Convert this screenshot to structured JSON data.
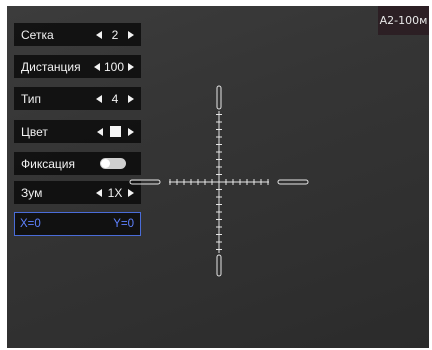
{
  "header": {
    "model": "A2-100м"
  },
  "menu": {
    "grid": {
      "label": "Сетка",
      "value": "2"
    },
    "distance": {
      "label": "Дистанция",
      "value": "100"
    },
    "type": {
      "label": "Тип",
      "value": "4"
    },
    "color": {
      "label": "Цвет",
      "value_color": "#f4f4f4"
    },
    "fixation": {
      "label": "Фиксация",
      "enabled": false
    },
    "zoom": {
      "label": "Зум",
      "value": "1X"
    }
  },
  "coordinates": {
    "x": "X=0",
    "y": "Y=0"
  },
  "colors": {
    "accent": "#5f82ff",
    "reticle": "#e6e6e6"
  }
}
